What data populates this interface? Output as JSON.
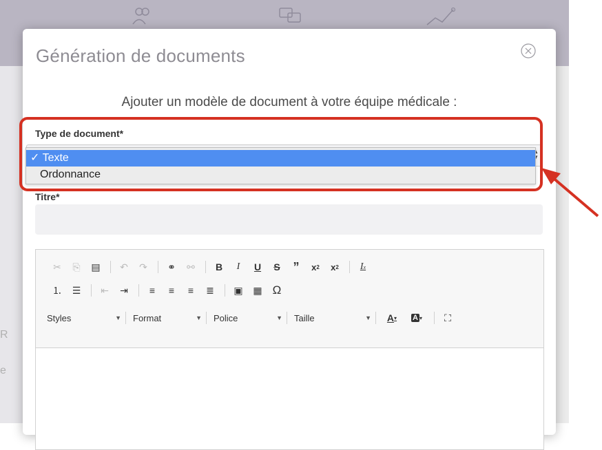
{
  "modal": {
    "title": "Génération de documents",
    "subtitle": "Ajouter un modèle de document à votre équipe médicale :"
  },
  "doc_type": {
    "label": "Type de document*",
    "options": [
      {
        "label": "✓ Texte",
        "selected": true
      },
      {
        "label": "Ordonnance",
        "selected": false
      }
    ]
  },
  "titre": {
    "label": "Titre*",
    "value": ""
  },
  "editor": {
    "styles_label": "Styles",
    "format_label": "Format",
    "police_label": "Police",
    "taille_label": "Taille"
  },
  "background": {
    "side_text_1": "R",
    "side_text_2": "e"
  },
  "colors": {
    "accent": "#4f8ef1",
    "highlight": "#d53122",
    "topbar": "#b9b5c2"
  }
}
